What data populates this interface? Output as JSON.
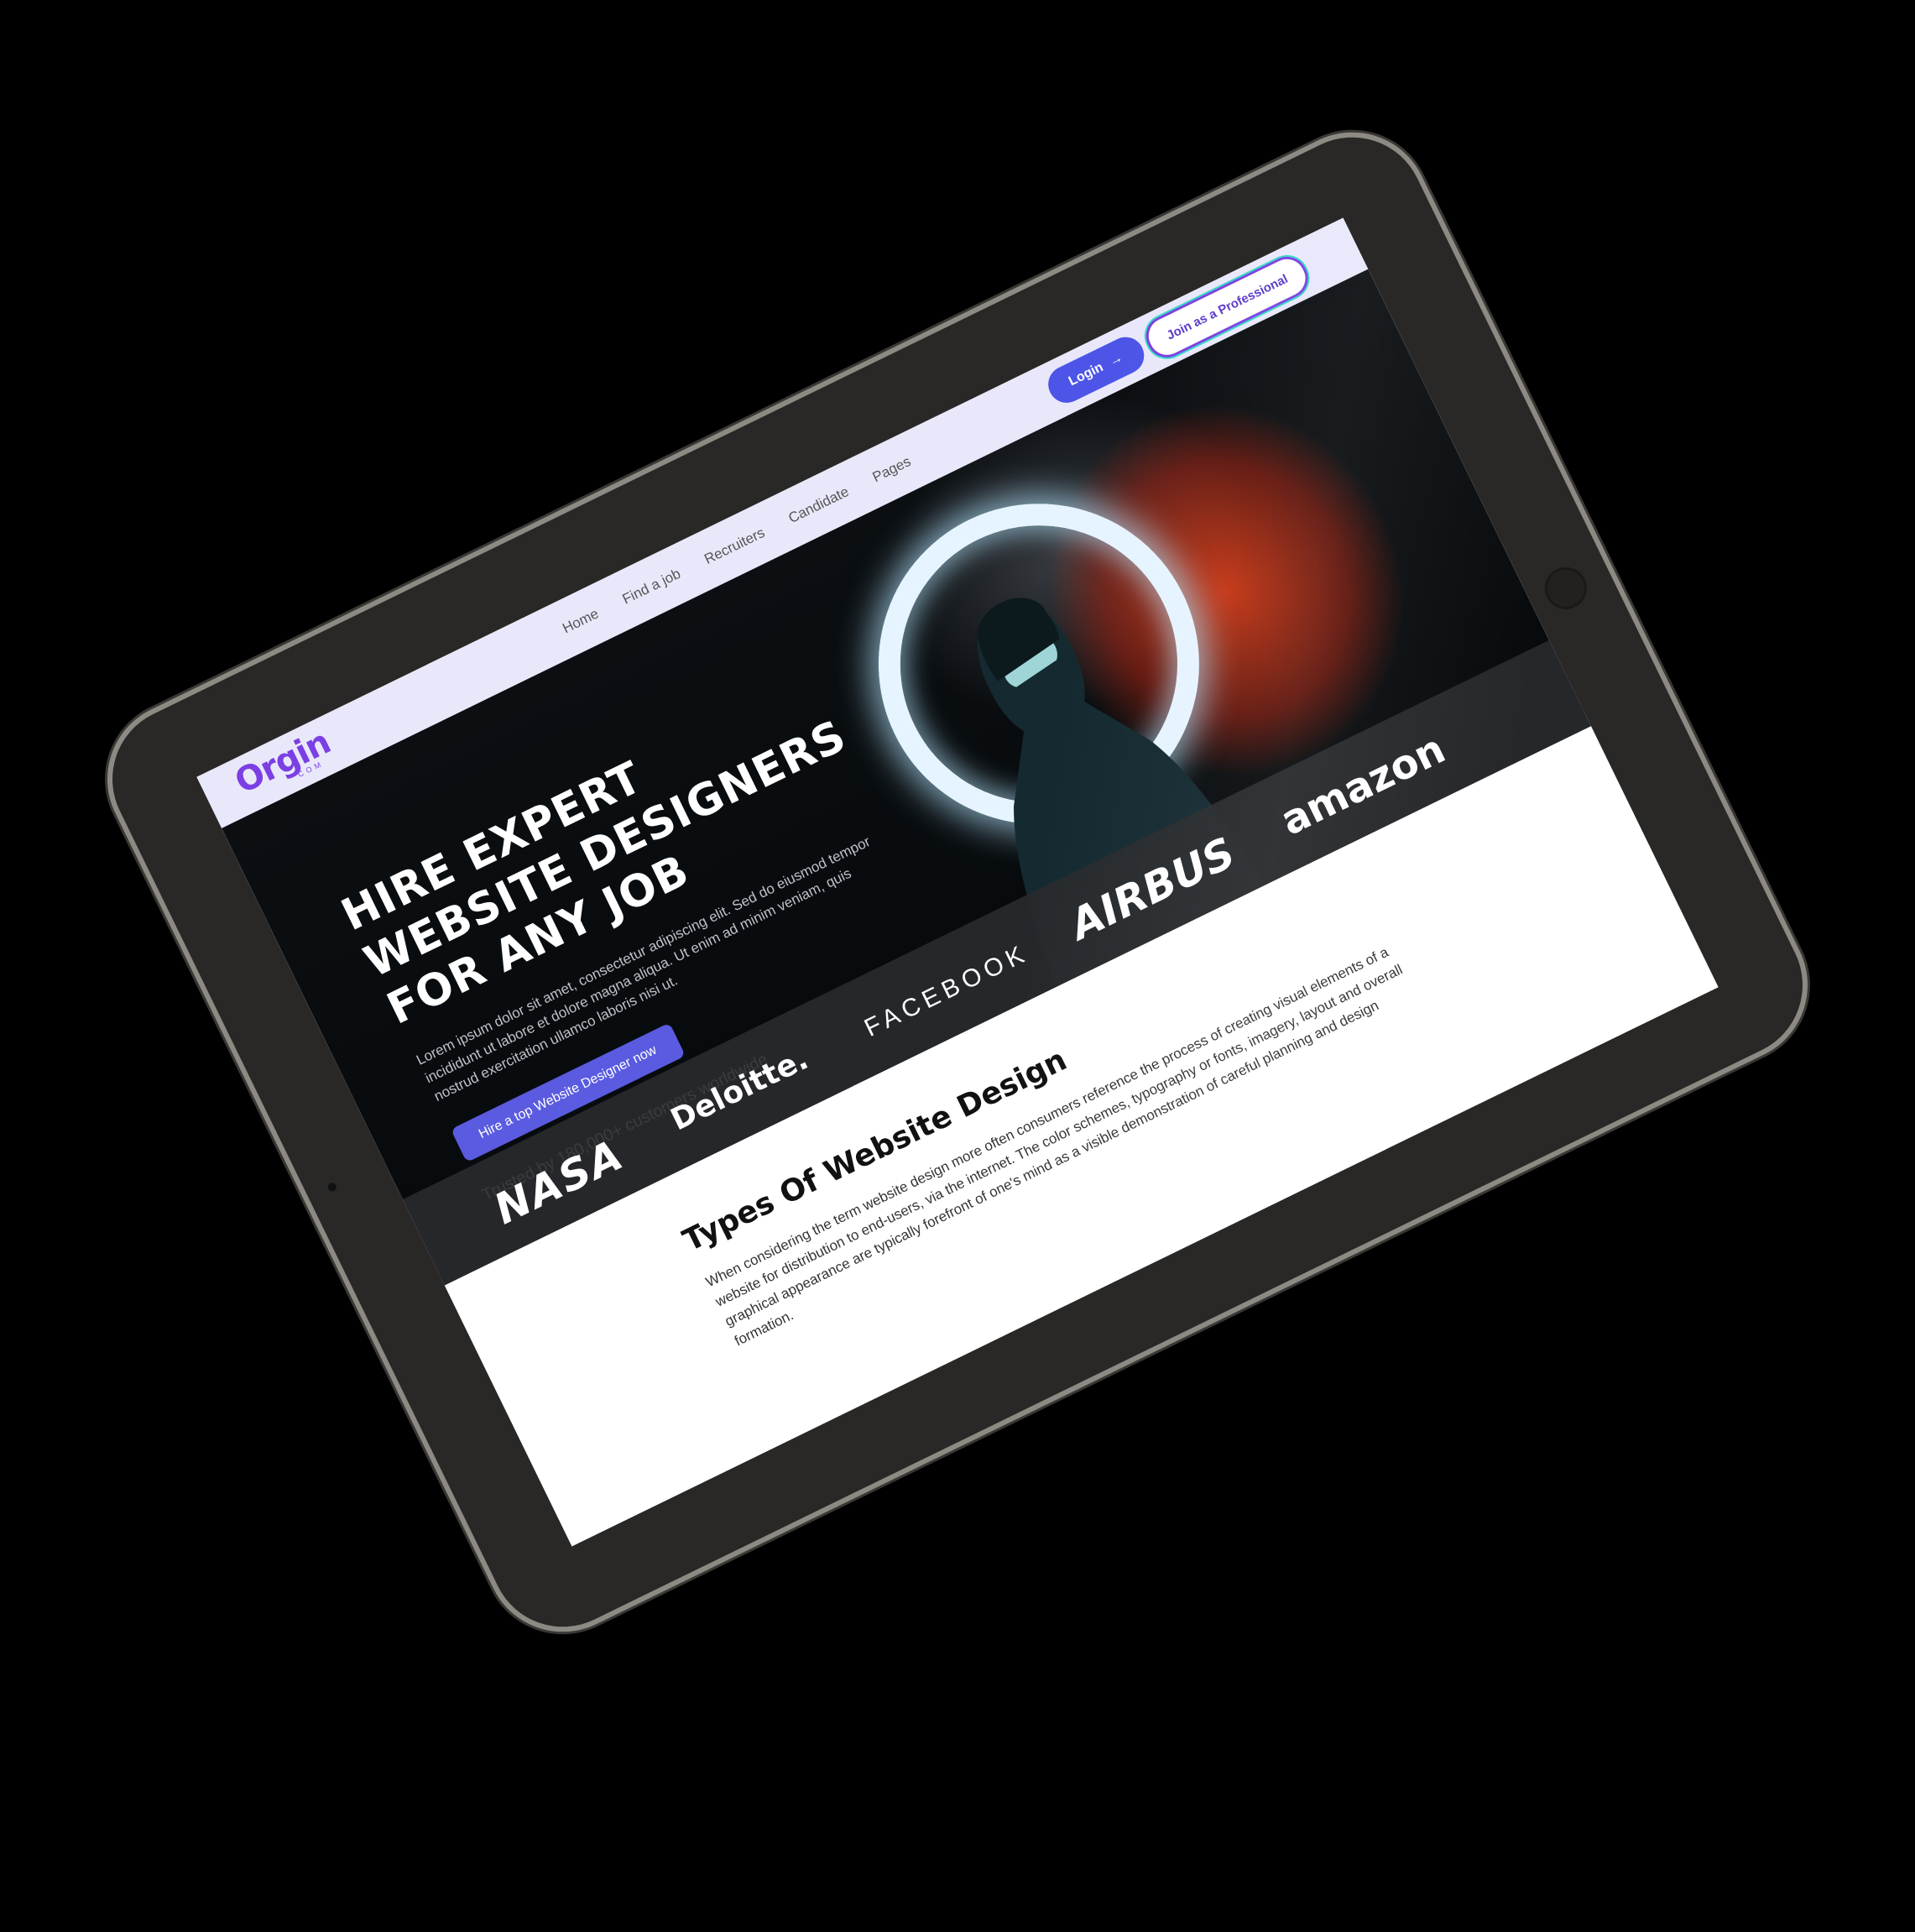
{
  "logo": {
    "text": "Orgin",
    "sub": "COM"
  },
  "nav": {
    "items": [
      "Home",
      "Find a job",
      "Recruiters",
      "Candidate",
      "Pages"
    ]
  },
  "header": {
    "login_label": "Login",
    "login_arrow": "→",
    "join_label": "Join as a Professional"
  },
  "hero": {
    "title_line1": "HIRE EXPERT",
    "title_line2": "WEBSITE DESIGNERS",
    "title_line3": "FOR ANY JOB",
    "description": "Lorem ipsum dolor sit amet, consectetur adipiscing elit. Sed do eiusmod tempor incididunt ut labore et dolore magna aliqua. Ut enim ad minim veniam, quis nostrud exercitation ullamco laboris nisi ut.",
    "cta_label": "Hire a top Website Designer now",
    "trusted": "Trusted by 180,000+ customers worldwide"
  },
  "brands": {
    "nasa": "NASA",
    "deloitte": "Deloitte.",
    "facebook": "FACEBOOK",
    "airbus": "AIRBUS",
    "amazon": "amazon"
  },
  "content": {
    "title": "Types  Of Website Design",
    "text": "When considering the term website design more often consumers reference the process of creating visual elements of a website for distribution to end-users, via the internet. The color schemes, typography or fonts, imagery, layout and overall graphical appearance are typically forefront of one's mind as a visible demonstration of careful planning and design formation."
  },
  "colors": {
    "accent": "#4d55e8",
    "brand": "#7b3fe4",
    "header_bg": "#e9e8fb"
  }
}
